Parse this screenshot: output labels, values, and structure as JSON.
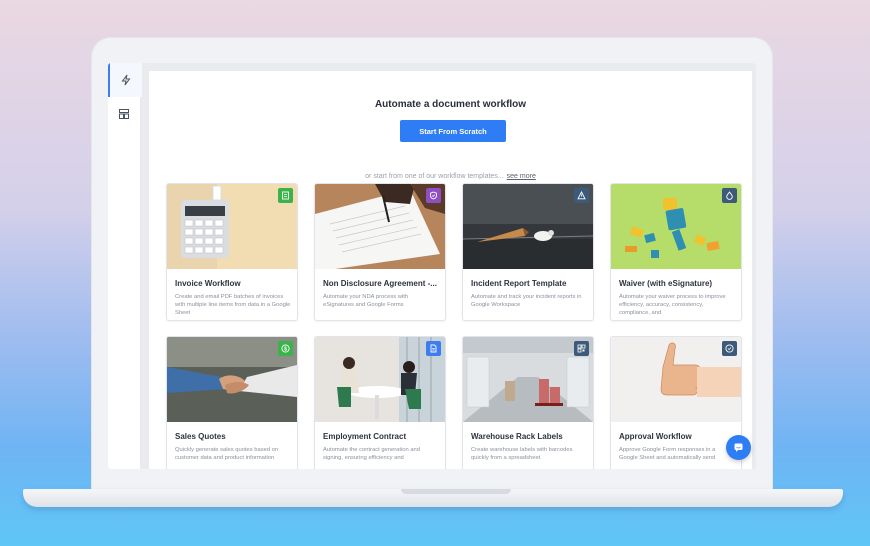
{
  "header": {
    "title": "Automate a document workflow",
    "start_button": "Start From Scratch",
    "hint_text": "or start from one of our workflow templates...",
    "see_more": "see more"
  },
  "sidebar": {
    "items": [
      {
        "icon": "lightning-icon",
        "active": true
      },
      {
        "icon": "layout-icon",
        "active": false
      }
    ]
  },
  "templates": [
    {
      "title": "Invoice Workflow",
      "desc": "Create and email PDF batches of invoices with multiple line items from data in a Google Sheet",
      "badge_color": "#3bb34a",
      "badge_icon": "document-icon"
    },
    {
      "title": "Non Disclosure Agreement -...",
      "desc": "Automate your NDA process with eSignatures and Google Forms",
      "badge_color": "#8e4fc4",
      "badge_icon": "shield-icon"
    },
    {
      "title": "Incident Report Template",
      "desc": "Automate and track your incident reports in Google Workspace",
      "badge_color": "#3e5a7a",
      "badge_icon": "warning-icon"
    },
    {
      "title": "Waiver (with eSignature)",
      "desc": "Automate your waiver process to improve efficiency, accuracy, consistency, compliance, and",
      "badge_color": "#3e5a7a",
      "badge_icon": "drop-icon"
    },
    {
      "title": "Sales Quotes",
      "desc": "Quickly generate sales quotes based on customer data and product information",
      "badge_color": "#3bb34a",
      "badge_icon": "dollar-icon"
    },
    {
      "title": "Employment Contract",
      "desc": "Automate the contract generation and signing, ensuring efficiency and",
      "badge_color": "#3d7cf2",
      "badge_icon": "file-icon"
    },
    {
      "title": "Warehouse Rack Labels",
      "desc": "Create warehouse labels with barcodes quickly from a spreadsheet",
      "badge_color": "#3e5a7a",
      "badge_icon": "qr-icon"
    },
    {
      "title": "Approval Workflow",
      "desc": "Approve Google Form responses in a Google Sheet and automatically send",
      "badge_color": "#3e5a7a",
      "badge_icon": "check-circle-icon"
    }
  ],
  "chat": {
    "icon": "chat-icon",
    "color": "#2f7df4"
  }
}
